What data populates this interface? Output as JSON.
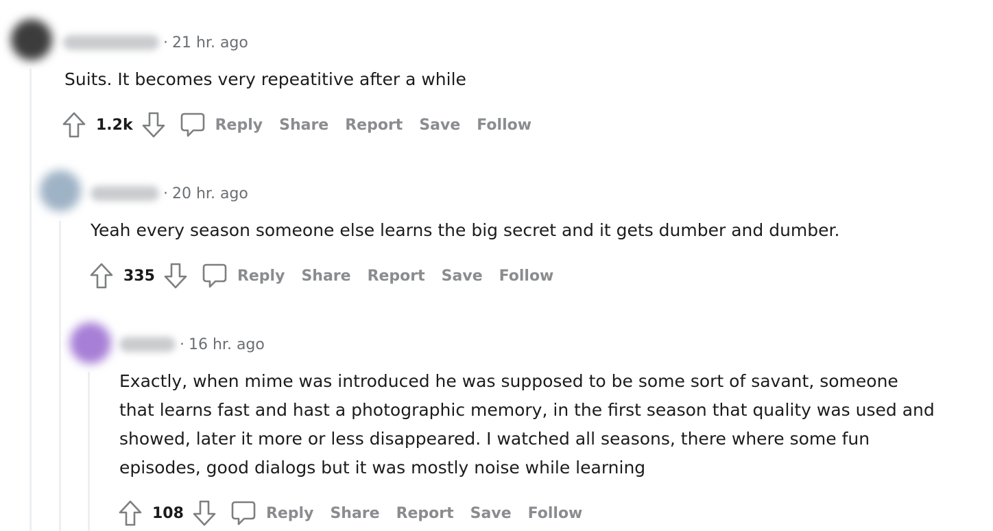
{
  "comments": [
    {
      "timestamp": "21 hr. ago",
      "separator": "·",
      "body": "Suits. It becomes very repeatitive after a while",
      "score": "1.2k",
      "actions": {
        "reply": "Reply",
        "share": "Share",
        "report": "Report",
        "save": "Save",
        "follow": "Follow"
      },
      "avatar_color": "#3c3c3c"
    },
    {
      "timestamp": "20 hr. ago",
      "separator": "·",
      "body": "Yeah every season someone else learns the big secret and it gets dumber and dumber.",
      "score": "335",
      "actions": {
        "reply": "Reply",
        "share": "Share",
        "report": "Report",
        "save": "Save",
        "follow": "Follow"
      },
      "avatar_color": "#9fb3c6"
    },
    {
      "timestamp": "16 hr. ago",
      "separator": "·",
      "body_lines": [
        "Exactly, when mime was introduced he was supposed to be some sort of savant, someone",
        "that learns fast and hast a photographic memory, in the first season that quality was used and",
        "showed, later it more or less disappeared. I watched all seasons, there where some fun",
        "episodes, good dialogs but it was mostly noise while learning"
      ],
      "score": "108",
      "actions": {
        "reply": "Reply",
        "share": "Share",
        "report": "Report",
        "save": "Save",
        "follow": "Follow"
      },
      "avatar_color": "#a77fd6"
    }
  ],
  "icons": {
    "upvote": "upvote-arrow-icon",
    "downvote": "downvote-arrow-icon",
    "reply": "speech-bubble-icon"
  }
}
